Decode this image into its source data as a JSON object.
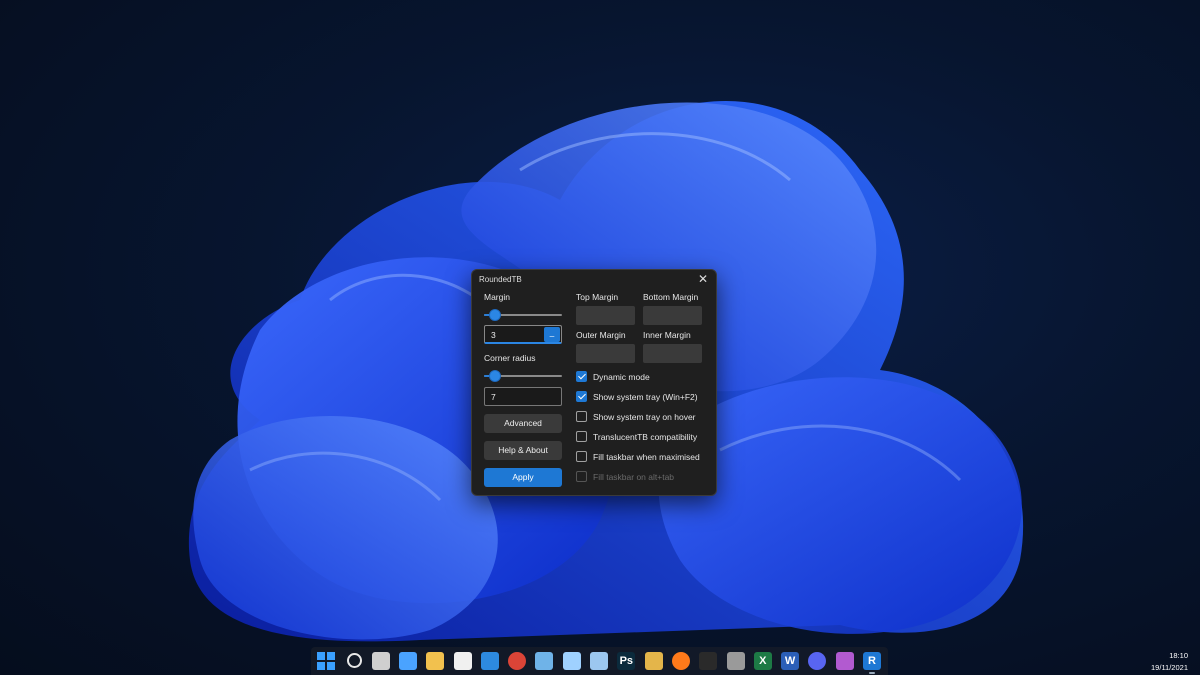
{
  "window": {
    "title": "RoundedTB",
    "close_glyph": "✕",
    "margin_label": "Margin",
    "margin_value": "3",
    "margin_slider_fraction": 0.08,
    "margin_spin_glyph": "_",
    "corner_radius_label": "Corner radius",
    "corner_radius_value": "7",
    "corner_slider_fraction": 0.08,
    "top_margin_label": "Top Margin",
    "bottom_margin_label": "Bottom Margin",
    "outer_margin_label": "Outer Margin",
    "inner_margin_label": "Inner Margin",
    "advanced_label": "Advanced",
    "help_label": "Help & About",
    "apply_label": "Apply",
    "checks": [
      {
        "label": "Dynamic mode",
        "checked": true,
        "enabled": true
      },
      {
        "label": "Show system tray (Win+F2)",
        "checked": true,
        "enabled": true
      },
      {
        "label": "Show system tray on hover",
        "checked": false,
        "enabled": true
      },
      {
        "label": "TranslucentTB compatibility",
        "checked": false,
        "enabled": true
      },
      {
        "label": "Fill taskbar when maximised",
        "checked": false,
        "enabled": true
      },
      {
        "label": "Fill taskbar on alt+tab",
        "checked": false,
        "enabled": false
      }
    ]
  },
  "taskbar": {
    "icons": [
      {
        "name": "start-icon",
        "color": "#3aa0ff"
      },
      {
        "name": "search-icon",
        "color": "#e8e8e8"
      },
      {
        "name": "task-view-icon",
        "color": "#cfcfcf"
      },
      {
        "name": "widgets-icon",
        "color": "#4aa3ff"
      },
      {
        "name": "file-explorer-icon",
        "color": "#f2c14e"
      },
      {
        "name": "store-icon",
        "color": "#f0f0f0"
      },
      {
        "name": "mail-icon",
        "color": "#2d8ae0"
      },
      {
        "name": "chrome-icon",
        "color": "#db4437"
      },
      {
        "name": "control-panel-icon",
        "color": "#6fb3e8"
      },
      {
        "name": "notepad-icon",
        "color": "#9fd1ff"
      },
      {
        "name": "photos-icon",
        "color": "#9cc7f0"
      },
      {
        "name": "photoshop-icon",
        "color": "#0b2a3c"
      },
      {
        "name": "paint-icon",
        "color": "#e4b54a"
      },
      {
        "name": "firefox-icon",
        "color": "#ff7a1a"
      },
      {
        "name": "terminal-icon",
        "color": "#2a2a2a"
      },
      {
        "name": "calculator-icon",
        "color": "#9a9a9a"
      },
      {
        "name": "excel-icon",
        "color": "#1d7a45"
      },
      {
        "name": "word-icon",
        "color": "#2b5fb8"
      },
      {
        "name": "discord-icon",
        "color": "#5865f2"
      },
      {
        "name": "media-player-icon",
        "color": "#b25ad0"
      },
      {
        "name": "roundedtb-icon",
        "color": "#1e78d4"
      }
    ],
    "glyphs": {
      "photoshop-icon": "Ps",
      "excel-icon": "X",
      "word-icon": "W",
      "roundedtb-icon": "R"
    }
  },
  "clock": {
    "time": "18:10",
    "date": "19/11/2021"
  }
}
